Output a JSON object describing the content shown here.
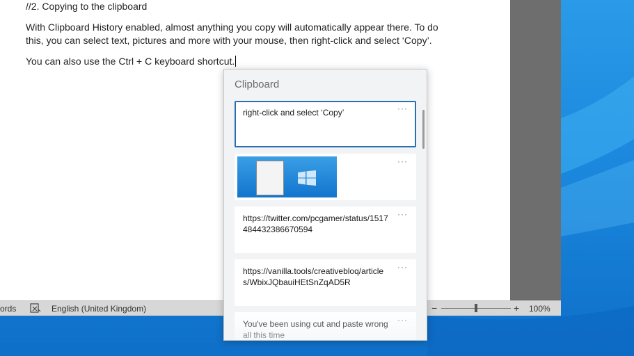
{
  "document": {
    "heading": "//2. Copying to the clipboard",
    "para1_line1": "With Clipboard History enabled, almost anything you copy will automatically appear there. To do",
    "para1_line2": "this, you can select text, pictures and more with your mouse, then right-click and select ‘Copy’.",
    "para2": "You can also use the Ctrl + C keyboard shortcut."
  },
  "statusbar": {
    "words": "ords",
    "language": "English (United Kingdom)",
    "zoom_minus": "−",
    "zoom_plus": "+",
    "zoom_percent": "100%",
    "zoom_level": 0.5
  },
  "clipboard": {
    "title": "Clipboard",
    "more_label": "···",
    "items": [
      {
        "type": "text",
        "text": "right-click and select ‘Copy’",
        "selected": true
      },
      {
        "type": "image",
        "icon": "screenshot-thumbnail"
      },
      {
        "type": "text",
        "text": "https://twitter.com/pcgamer/status/1517484432386670594"
      },
      {
        "type": "text",
        "text": "https://vanilla.tools/creativebloq/articles/WbixJQbauiHEtSnZqAD5R"
      },
      {
        "type": "text",
        "text": "You've been using cut and paste wrong all this time"
      }
    ]
  },
  "colors": {
    "selection_border": "#2a6fb3",
    "desktop_blue": "#1a86dc"
  }
}
